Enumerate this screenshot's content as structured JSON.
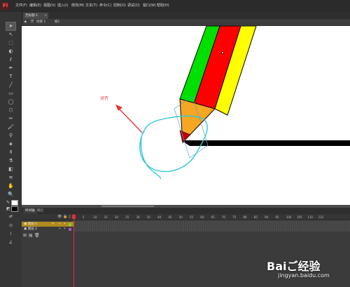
{
  "app": {
    "logo_text": "Fl"
  },
  "menu": [
    "文件(F)",
    "编辑(E)",
    "视图(V)",
    "插入(I)",
    "修改(M)",
    "文本(T)",
    "命令(C)",
    "控制(O)",
    "调试(D)",
    "窗口(W)",
    "帮助(H)"
  ],
  "document_tab": {
    "title": "无标题-1",
    "close": "×"
  },
  "edit_bar": {
    "scene_label": "场景 1",
    "frame_label": "帧1"
  },
  "canvas": {
    "annotation": "对齐"
  },
  "timeline": {
    "tabs": [
      "时间轴",
      "输出"
    ],
    "frame_numbers": [
      "1",
      "5",
      "10",
      "15",
      "20",
      "25",
      "30",
      "35",
      "40",
      "45",
      "50",
      "55",
      "60",
      "65",
      "70",
      "75",
      "80",
      "85",
      "90",
      "95",
      "100",
      "105",
      "110",
      "115"
    ],
    "layers": [
      {
        "name": "图层 1",
        "selected": true
      },
      {
        "name": "图层 2",
        "selected": false
      }
    ]
  },
  "colors": {
    "pencil_green": "#00e000",
    "pencil_red": "#ff0000",
    "pencil_yellow": "#ffff00",
    "pencil_wood": "#f5a623",
    "annotation": "#e83030",
    "circle_stroke": "#33c8d8",
    "selection": "#ffc000"
  },
  "watermark": {
    "brand": "Baiご经验",
    "url": "jingyan.baidu.com"
  }
}
